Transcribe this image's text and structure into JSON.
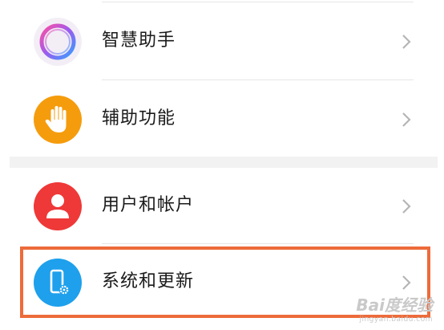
{
  "settings": {
    "items": [
      {
        "label": "智慧助手",
        "icon": "smart-assistant-icon"
      },
      {
        "label": "辅助功能",
        "icon": "hand-icon"
      },
      {
        "label": "用户和帐户",
        "icon": "user-icon"
      },
      {
        "label": "系统和更新",
        "icon": "phone-settings-icon"
      }
    ]
  },
  "colors": {
    "accessibility": "#f59c0d",
    "users": "#ef3838",
    "system": "#1ea0ec",
    "highlight": "#ed6b3a"
  },
  "watermark": {
    "main": "Bai度经验",
    "sub": "jingyan.baidu.com"
  }
}
